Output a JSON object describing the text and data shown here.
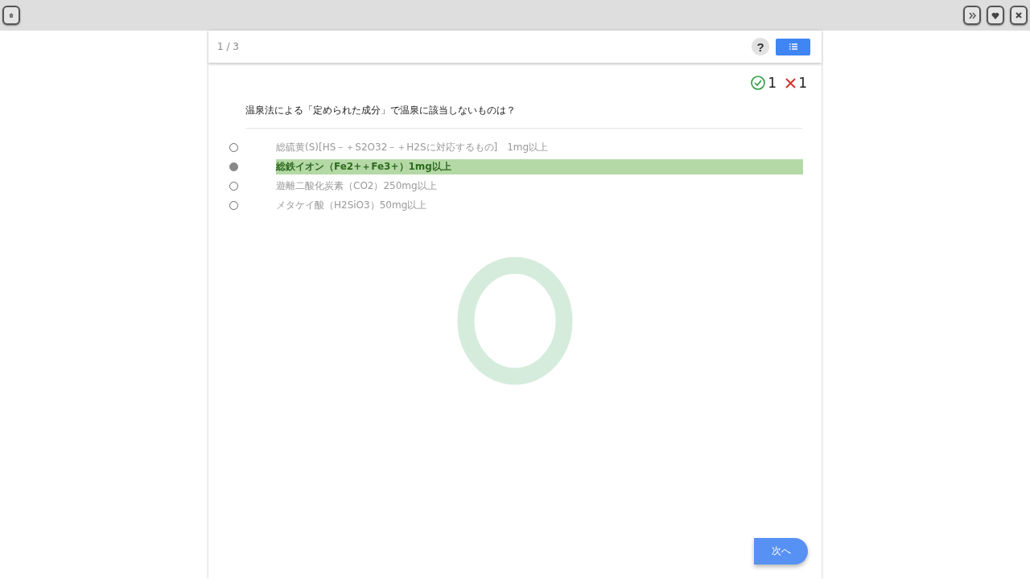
{
  "header": {
    "progress": "1 / 3",
    "help": "?"
  },
  "score": {
    "correct": "1",
    "wrong": "1"
  },
  "question": "温泉法による「定められた成分」で温泉に該当しないものは？",
  "options": [
    {
      "label": "総硫黄(S)[HS－＋S2O32－＋H2Sに対応するもの]　1mg以上",
      "selected": false
    },
    {
      "label": "総鉄イオン（Fe2+＋Fe3+）1mg以上",
      "selected": true
    },
    {
      "label": "遊離二酸化炭素（CO2）250mg以上",
      "selected": false
    },
    {
      "label": "メタケイ酸（H2SiO3）50mg以上",
      "selected": false
    }
  ],
  "next_button": "次へ"
}
